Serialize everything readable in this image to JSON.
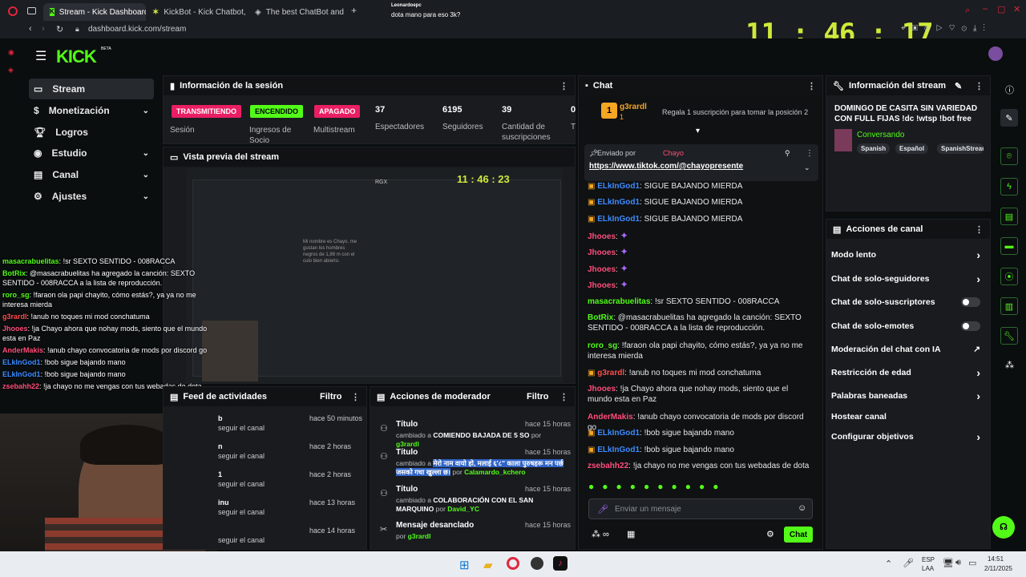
{
  "browser": {
    "tabs": [
      {
        "label": "Stream - Kick Dashboard"
      },
      {
        "label": "KickBot - Kick Chatbot, A"
      },
      {
        "label": "The best ChatBot and"
      }
    ],
    "url": "dashboard.kick.com/stream",
    "overlay_user": "Leonardoepc",
    "overlay_msg": "dota mano para eso 3k?",
    "clock": "11 : 46 : 17"
  },
  "kick": {
    "logo": "KICK",
    "beta": "BETA"
  },
  "sidebar": {
    "items": [
      {
        "label": "Stream"
      },
      {
        "label": "Monetización"
      },
      {
        "label": "Logros"
      },
      {
        "label": "Estudio"
      },
      {
        "label": "Canal"
      },
      {
        "label": "Ajustes"
      }
    ]
  },
  "session": {
    "title": "Información de la sesión",
    "badges": [
      {
        "label": "TRANSMITIENDO",
        "sub": "Sesión"
      },
      {
        "label": "ENCENDIDO",
        "sub": "Ingresos de Socio"
      },
      {
        "label": "APAGADO",
        "sub": "Multistream"
      }
    ],
    "stats": [
      {
        "value": "37",
        "label": "Espectadores"
      },
      {
        "value": "6195",
        "label": "Seguidores"
      },
      {
        "value": "39",
        "label": "Cantidad de suscripciones"
      },
      {
        "value": "0",
        "label": "T"
      }
    ]
  },
  "preview": {
    "title": "Vista previa del stream",
    "clock": "11 : 46 : 23",
    "rgx": "RGX",
    "note": "Mi nombre es Chayo, me gustan los hombres negros de 1,88 m con el culo bien abierto."
  },
  "overlay_chat": [
    {
      "user": "masacrabuelitas",
      "msg": "!sr SEXTO SENTIDO - 008RACCA",
      "color": "#53fc18"
    },
    {
      "user": "BotRix",
      "msg": "@masacrabuelitas ha agregado la canción: SEXTO SENTIDO - 008RACCA a la lista de reproducción.",
      "color": "#53fc18"
    },
    {
      "user": "roro_sg",
      "msg": "!faraon ola papi chayito, cómo estás?, ya ya no me interesa mierda",
      "color": "#53fc18"
    },
    {
      "user": "g3rardl",
      "msg": "!anub no toques mi mod conchatuma",
      "color": "#ff4d4d"
    },
    {
      "user": "Jhooes",
      "msg": "!ja Chayo ahora que nohay mods, siento que el mundo esta en Paz",
      "color": "#ff4d7a"
    },
    {
      "user": "AnderMakis",
      "msg": "!anub chayo convocatoria de mods por discord go",
      "color": "#ff4d7a"
    },
    {
      "user": "ELkInGod1",
      "msg": "!bob sigue bajando mano",
      "color": "#3d8bff"
    },
    {
      "user": "ELkInGod1",
      "msg": "!bob sigue bajando mano",
      "color": "#3d8bff"
    },
    {
      "user": "zsebahh22",
      "msg": "!ja chayo no me vengas con tus webadas de dota",
      "color": "#ff4d7a"
    }
  ],
  "feed": {
    "title": "Feed de actividades",
    "filter": "Filtro",
    "items": [
      {
        "action": "seguir el canal",
        "time": "hace 50 minutos",
        "name": "b"
      },
      {
        "action": "seguir el canal",
        "time": "hace 2 horas",
        "name": "n"
      },
      {
        "action": "seguir el canal",
        "time": "hace 2 horas",
        "name": "1"
      },
      {
        "action": "seguir el canal",
        "time": "hace 13 horas",
        "name": "inu"
      },
      {
        "action": "seguir el canal",
        "time": "hace 14 horas",
        "name": ""
      }
    ]
  },
  "mod": {
    "title": "Acciones de moderador",
    "filter": "Filtro",
    "items": [
      {
        "title": "Título",
        "time": "hace 15 horas",
        "pre": "cambiado a",
        "value": "COMIENDO BAJADA DE 5 SO",
        "by": "por",
        "user": "g3rardl"
      },
      {
        "title": "Título",
        "time": "hace 15 horas",
        "pre": "cambiado a",
        "value": "मेरो नाम वायो हो, मलाई ६'८\" काला पुरुषहरू मन पर्छ जसको गधा खुल्ला छ।",
        "by": "por",
        "user": "Calamardo_kchero"
      },
      {
        "title": "Título",
        "time": "hace 15 horas",
        "pre": "cambiado a",
        "value": "COLABORACIÓN CON EL SAN MARQUINO",
        "by": "por",
        "user": "David_YC"
      },
      {
        "title": "Mensaje desanclado",
        "time": "hace 15 horas",
        "pre": "",
        "value": "",
        "by": "por",
        "user": "g3rardl"
      }
    ]
  },
  "chat": {
    "title": "Chat",
    "top_user": "g3rardl",
    "top_count": "1",
    "top_rank": "1",
    "gift_cta": "Regala 1 suscripción para tomar la posición 2",
    "pinned_by": "Enviado por",
    "pinned_user": "Chayo",
    "pinned_link": "https://www.tiktok.com/@chayopresente",
    "messages": [
      {
        "user": "ELkInGod1",
        "msg": "SIGUE BAJANDO MIERDA",
        "color": "#3d8bff"
      },
      {
        "user": "ELkInGod1",
        "msg": "SIGUE BAJANDO MIERDA",
        "color": "#3d8bff"
      },
      {
        "user": "ELkInGod1",
        "msg": "SIGUE BAJANDO MIERDA",
        "color": "#3d8bff"
      },
      {
        "user": "Jhooes",
        "msg": "",
        "color": "#ff4d7a"
      },
      {
        "user": "Jhooes",
        "msg": "",
        "color": "#ff4d7a"
      },
      {
        "user": "Jhooes",
        "msg": "",
        "color": "#ff4d7a"
      },
      {
        "user": "Jhooes",
        "msg": "",
        "color": "#ff4d7a"
      },
      {
        "user": "masacrabuelitas",
        "msg": "!sr SEXTO SENTIDO - 008RACCA",
        "color": "#53fc18"
      },
      {
        "user": "BotRix",
        "msg": "@masacrabuelitas ha agregado la canción: SEXTO SENTIDO - 008RACCA a la lista de reproducción.",
        "color": "#53fc18"
      },
      {
        "user": "roro_sg",
        "msg": "!faraon ola papi chayito, cómo estás?, ya ya no me interesa mierda",
        "color": "#53fc18"
      },
      {
        "user": "g3rardl",
        "msg": "!anub no toques mi mod conchatuma",
        "color": "#ff4d4d"
      },
      {
        "user": "Jhooes",
        "msg": "!ja Chayo ahora que nohay mods, siento que el mundo esta en Paz",
        "color": "#ff4d7a"
      },
      {
        "user": "AnderMakis",
        "msg": "!anub chayo convocatoria de mods por discord go",
        "color": "#ff4d7a"
      },
      {
        "user": "ELkInGod1",
        "msg": "!bob sigue bajando mano",
        "color": "#3d8bff"
      },
      {
        "user": "ELkInGod1",
        "msg": "!bob sigue bajando mano",
        "color": "#3d8bff"
      },
      {
        "user": "zsebahh22",
        "msg": "!ja chayo no me vengas con tus webadas de dota",
        "color": "#ff4d7a"
      }
    ],
    "input_placeholder": "Enviar un mensaje",
    "send": "Chat"
  },
  "stream_info": {
    "title": "Información del stream",
    "stream_title": "DOMINGO DE CASITA SIN VARIEDAD CON FULL FIJAS !dc !wtsp !bot free",
    "category": "Conversando",
    "tags": [
      "Spanish",
      "Español",
      "SpanishStream"
    ]
  },
  "channel_actions": {
    "title": "Acciones de canal",
    "items": [
      {
        "label": "Modo lento",
        "control": "chevron"
      },
      {
        "label": "Chat de solo-seguidores",
        "control": "chevron"
      },
      {
        "label": "Chat de solo-suscriptores",
        "control": "toggle"
      },
      {
        "label": "Chat de solo-emotes",
        "control": "toggle"
      },
      {
        "label": "Moderación del chat con IA",
        "control": "external"
      },
      {
        "label": "Restricción de edad",
        "control": "chevron"
      },
      {
        "label": "Palabras baneadas",
        "control": "chevron"
      },
      {
        "label": "Hostear canal",
        "control": "none"
      },
      {
        "label": "Configurar objetivos",
        "control": "chevron"
      }
    ]
  },
  "taskbar": {
    "lang1": "ESP",
    "lang2": "LAA",
    "time": "14:51",
    "date": "2/11/2025"
  },
  "colors": {
    "kick_green": "#53fc18",
    "live_red": "#e91e63",
    "panel": "#191b1f",
    "bg": "#0b0e0f"
  }
}
